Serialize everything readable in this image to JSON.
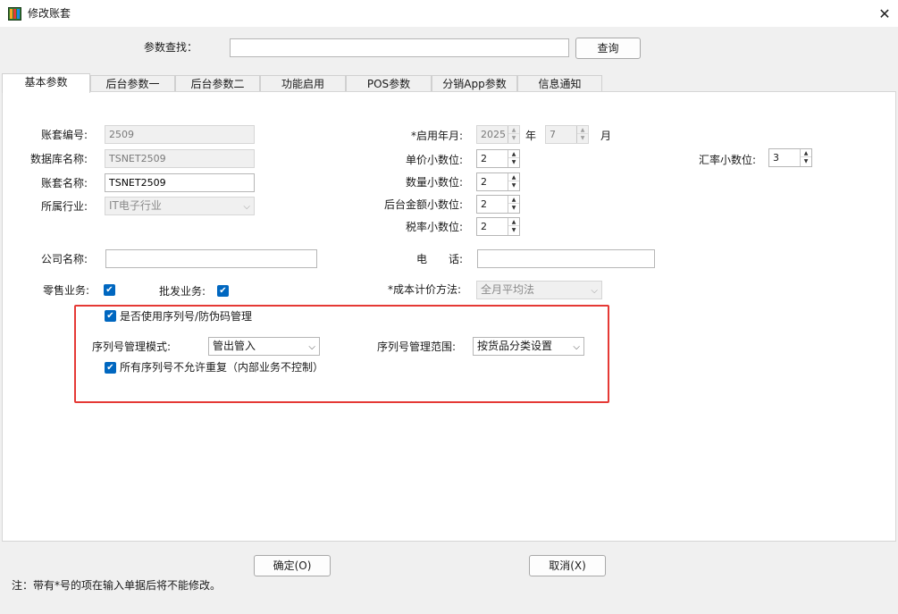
{
  "window": {
    "title": "修改账套",
    "close_glyph": "✕"
  },
  "search": {
    "label": "参数查找：",
    "value": "",
    "button": "查询"
  },
  "tabs": [
    {
      "label": "基本参数",
      "active": true
    },
    {
      "label": "后台参数一"
    },
    {
      "label": "后台参数二"
    },
    {
      "label": "功能启用"
    },
    {
      "label": "POS参数"
    },
    {
      "label": "分销App参数"
    },
    {
      "label": "信息通知"
    }
  ],
  "basic": {
    "account_no_label": "账套编号:",
    "account_no_value": "2509",
    "db_name_label": "数据库名称:",
    "db_name_value": "TSNET2509",
    "account_name_label": "账套名称:",
    "account_name_value": "TSNET2509",
    "industry_label": "所属行业:",
    "industry_value": "IT电子行业",
    "start_label": "*启用年月:",
    "start_year": "2025",
    "year_unit": "年",
    "start_month": "7",
    "month_unit": "月",
    "price_dec_label": "单价小数位:",
    "price_dec_value": "2",
    "qty_dec_label": "数量小数位:",
    "qty_dec_value": "2",
    "amount_dec_label": "后台金额小数位:",
    "amount_dec_value": "2",
    "tax_dec_label": "税率小数位:",
    "tax_dec_value": "2",
    "rate_dec_label": "汇率小数位:",
    "rate_dec_value": "3",
    "company_label": "公司名称:",
    "company_value": "",
    "phone_label": "电　　话:",
    "phone_value": "",
    "retail_label": "零售业务:",
    "wholesale_label": "批发业务:",
    "cost_label": "*成本计价方法:",
    "cost_value": "全月平均法"
  },
  "serial": {
    "use_label": "是否使用序列号/防伪码管理",
    "mode_label": "序列号管理模式:",
    "mode_value": "管出管入",
    "scope_label": "序列号管理范围:",
    "scope_value": "按货品分类设置",
    "no_dup_label": "所有序列号不允许重复（内部业务不控制）"
  },
  "footer": {
    "ok": "确定(O)",
    "cancel": "取消(X)",
    "note": "注：带有*号的项在输入单据后将不能修改。"
  },
  "icons": {
    "app": "app-icon",
    "close": "close-icon",
    "check": "check-icon",
    "chevron": "chevron-down-icon",
    "spin_up": "spin-up-icon",
    "spin_down": "spin-down-icon"
  },
  "colors": {
    "accent": "#0067c0",
    "highlight_border": "#e53935"
  }
}
